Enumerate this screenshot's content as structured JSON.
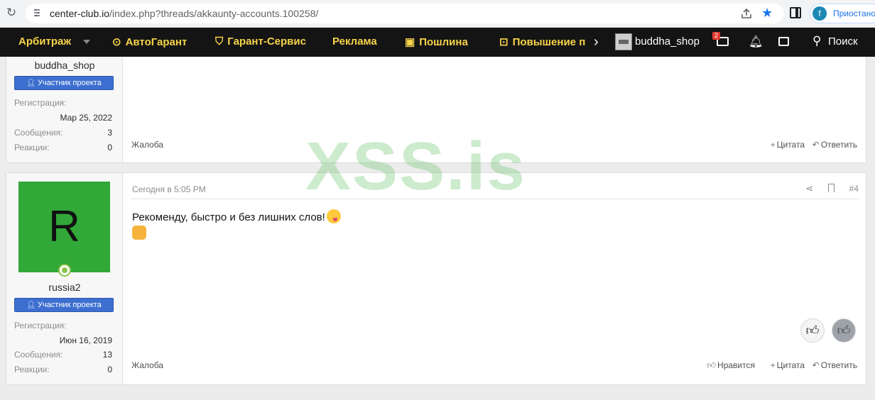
{
  "browser": {
    "url_host": "center-club.io",
    "url_path": "/index.php?threads/akkaunty-accounts.100258/",
    "profile_initial": "f",
    "profile_label": "Приостано"
  },
  "navbar": {
    "items": [
      {
        "label": "Арбитраж",
        "icon": ""
      },
      {
        "label": "АвтоГарант",
        "icon": "money-icon"
      },
      {
        "label": "Гарант-Сервис",
        "icon": "shield-icon"
      },
      {
        "label": "Реклама",
        "icon": ""
      },
      {
        "label": "Пошлина",
        "icon": "banknote-icon"
      },
      {
        "label": "Повышение п",
        "icon": "lock-icon"
      }
    ],
    "username": "buddha_shop",
    "mail_badge": "2",
    "search_label": "Поиск",
    "accent_color": "#f7d34a"
  },
  "post1": {
    "username": "buddha_shop",
    "role": "Участник проекта",
    "reg_label": "Регистрация:",
    "reg_value": "Мар 25, 2022",
    "msgs_label": "Сообщения:",
    "msgs_value": "3",
    "react_label": "Реакции:",
    "react_value": "0",
    "report": "Жалоба",
    "quote": "Цитата",
    "reply": "Ответить"
  },
  "post2": {
    "avatar_letter": "R",
    "username": "russia2",
    "role": "Участник проекта",
    "reg_label": "Регистрация:",
    "reg_value": "Июн 16, 2019",
    "msgs_label": "Сообщения:",
    "msgs_value": "13",
    "react_label": "Реакции:",
    "react_value": "0",
    "date": "Сегодня в 5:05 PM",
    "post_number": "#4",
    "message": "Рекоменду, быстро и без лишних слов!",
    "report": "Жалоба",
    "like": "Нравится",
    "quote": "Цитата",
    "reply": "Ответить"
  },
  "watermark": "XSS.is"
}
